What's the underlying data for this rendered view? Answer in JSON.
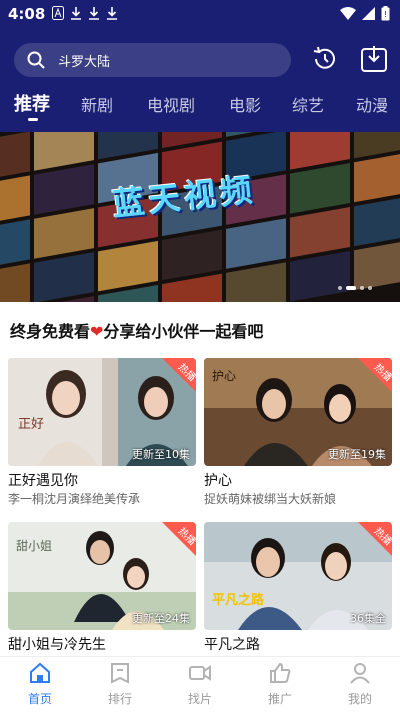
{
  "status_bar": {
    "time": "4:08"
  },
  "search": {
    "text": "斗罗大陆"
  },
  "tabs": [
    {
      "label": "推荐"
    },
    {
      "label": "新剧"
    },
    {
      "label": "电视剧"
    },
    {
      "label": "电影"
    },
    {
      "label": "综艺"
    },
    {
      "label": "动漫"
    }
  ],
  "banner": {
    "title": "蓝天视频"
  },
  "section": {
    "title_part1": "终身免费看",
    "title_part2": "分享给小伙伴一起看吧"
  },
  "cards": [
    {
      "badge": "热播",
      "episodes": "更新至10集",
      "title": "正好遇见你",
      "subtitle": "李一桐沈月演绎绝美传承"
    },
    {
      "badge": "热播",
      "episodes": "更新至19集",
      "title": "护心",
      "subtitle": "捉妖萌妹被绑当大妖新娘"
    },
    {
      "badge": "热播",
      "episodes": "更新至24集",
      "title": "甜小姐与冷先生",
      "subtitle": ""
    },
    {
      "badge": "热播",
      "episodes": "36集全",
      "title": "平凡之路",
      "subtitle": ""
    }
  ],
  "bottom_nav": [
    {
      "label": "首页",
      "icon": "home-icon"
    },
    {
      "label": "排行",
      "icon": "ranking-icon"
    },
    {
      "label": "找片",
      "icon": "video-camera-icon"
    },
    {
      "label": "推广",
      "icon": "thumbs-up-icon"
    },
    {
      "label": "我的",
      "icon": "person-icon"
    }
  ],
  "colors": {
    "header": "#1b1f73",
    "accent": "#2f7cf6",
    "badge": "#ff5a4e",
    "heart": "#e02a2a"
  }
}
